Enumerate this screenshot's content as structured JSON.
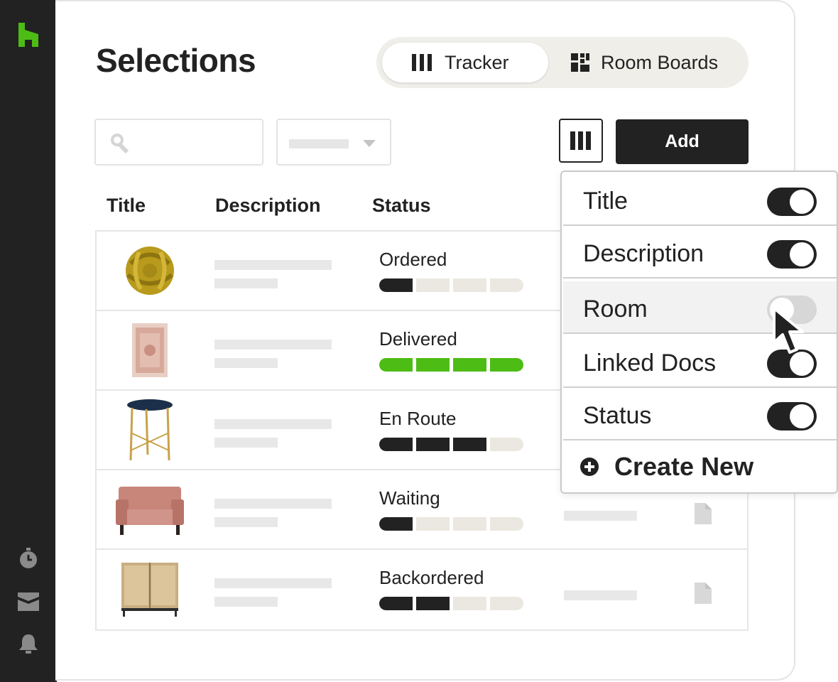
{
  "sidebar": {
    "logo_icon": "houzz-logo-icon",
    "logo_color": "#4dbc15",
    "items": [
      {
        "icon": "stopwatch-icon"
      },
      {
        "icon": "inbox-icon"
      },
      {
        "icon": "bell-icon"
      }
    ]
  },
  "page": {
    "title": "Selections"
  },
  "view_switch": {
    "tracker_label": "Tracker",
    "boards_label": "Room Boards",
    "active": "Tracker"
  },
  "toolbar": {
    "search_icon": "search-icon",
    "add_label": "Add",
    "columns_icon": "columns-icon"
  },
  "table": {
    "headers": [
      "Title",
      "Description",
      "Status"
    ],
    "rows": [
      {
        "thumb": "knot-pillow",
        "status": "Ordered",
        "progress_filled": 1,
        "progress_total": 4,
        "progress_color": "#222222"
      },
      {
        "thumb": "area-rug",
        "status": "Delivered",
        "progress_filled": 4,
        "progress_total": 4,
        "progress_color": "#4dbc15"
      },
      {
        "thumb": "side-table",
        "status": "En Route",
        "progress_filled": 3,
        "progress_total": 4,
        "progress_color": "#222222"
      },
      {
        "thumb": "armchair",
        "status": "Waiting",
        "progress_filled": 1,
        "progress_total": 4,
        "progress_color": "#222222"
      },
      {
        "thumb": "rattan-cabinet",
        "status": "Backordered",
        "progress_filled": 2,
        "progress_total": 4,
        "progress_color": "#222222"
      }
    ]
  },
  "column_menu": {
    "options": [
      {
        "label": "Title",
        "enabled": true
      },
      {
        "label": "Description",
        "enabled": true
      },
      {
        "label": "Room",
        "enabled": false
      },
      {
        "label": "Linked Docs",
        "enabled": true
      },
      {
        "label": "Status",
        "enabled": true
      }
    ],
    "create_label": "Create New"
  },
  "colors": {
    "accent": "#4dbc15",
    "dark": "#222222",
    "progress_empty": "#ebe8e1"
  }
}
